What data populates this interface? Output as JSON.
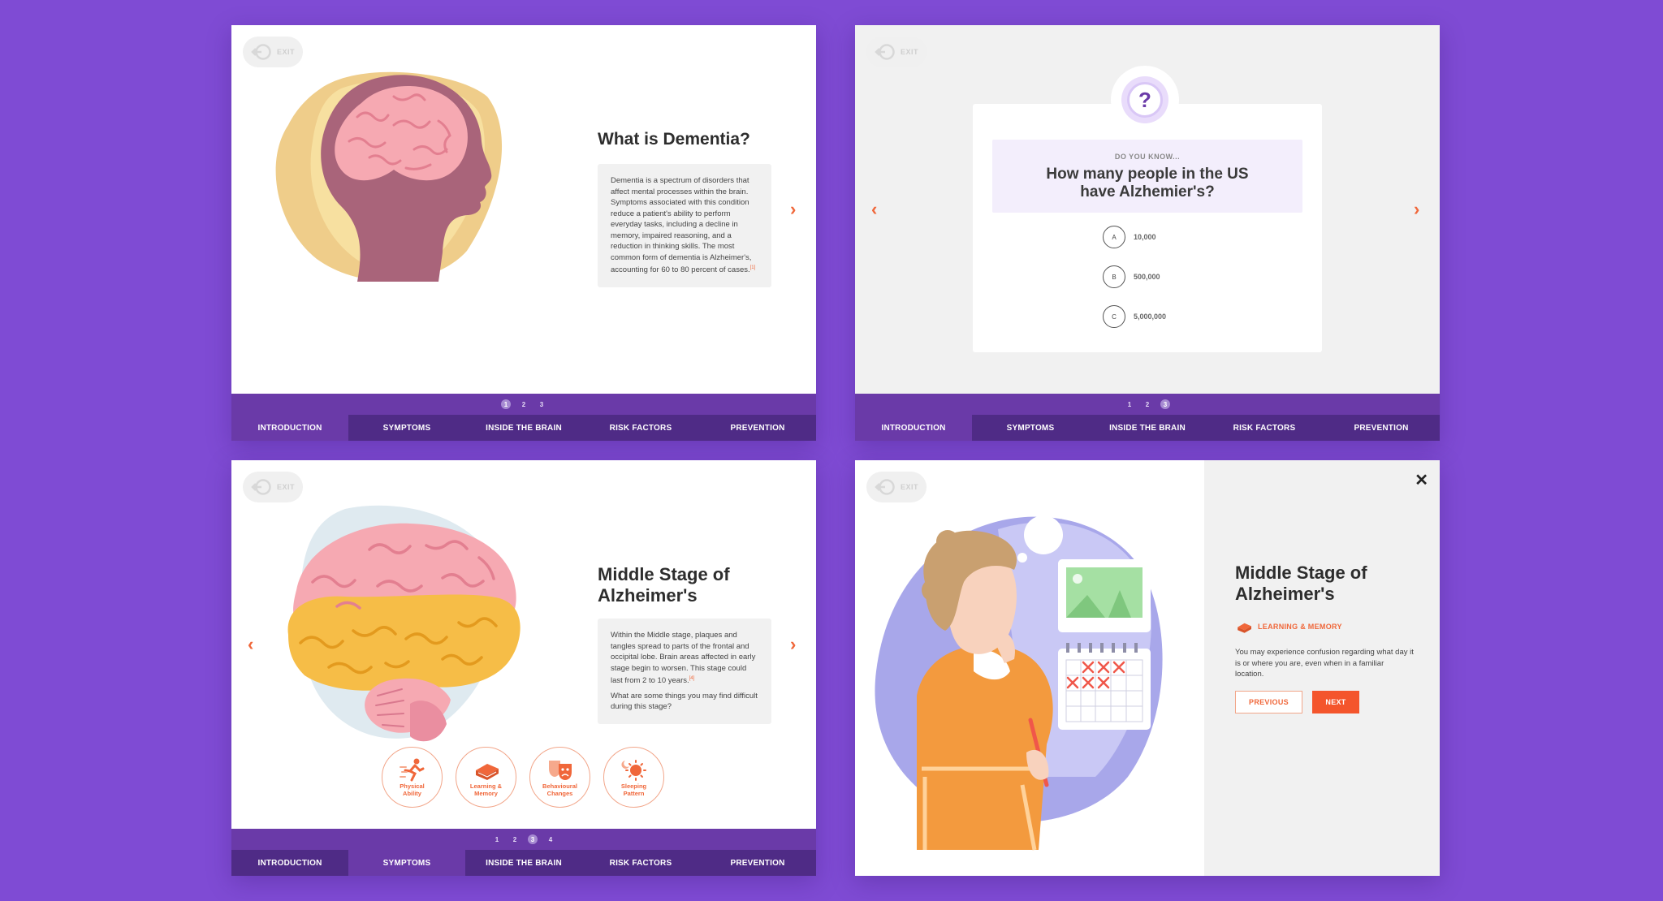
{
  "colors": {
    "background": "#7f4bd4",
    "accent": "#f0673a",
    "nav": "#4f2b86",
    "nav_active": "#6a3aa8"
  },
  "exit_label": "EXIT",
  "tabs": [
    "INTRODUCTION",
    "SYMPTOMS",
    "INSIDE THE BRAIN",
    "RISK FACTORS",
    "PREVENTION"
  ],
  "panel1": {
    "title": "What is Dementia?",
    "body": "Dementia is a spectrum of disorders that affect mental processes within the brain. Symptoms associated with this condition reduce a patient's ability to perform everyday tasks, including a decline in memory, impaired reasoning, and a reduction in thinking skills. The most common form of dementia is Alzheimer's, accounting for 60 to 80 percent of cases.",
    "ref": "[1]",
    "pages": [
      "1",
      "2",
      "3"
    ],
    "active_page": "1",
    "active_tab": "INTRODUCTION"
  },
  "panel2": {
    "pre": "DO YOU KNOW...",
    "question": "How many people in the US have Alzhemier's?",
    "options": [
      {
        "letter": "A",
        "value": "10,000"
      },
      {
        "letter": "B",
        "value": "500,000"
      },
      {
        "letter": "C",
        "value": "5,000,000"
      }
    ],
    "pages": [
      "1",
      "2",
      "3"
    ],
    "active_page": "3",
    "active_tab": "INTRODUCTION"
  },
  "panel3": {
    "title": "Middle Stage of Alzheimer's",
    "body": "Within the Middle stage, plaques and tangles spread to parts of the frontal and occipital lobe. Brain areas affected in early stage begin to worsen. This stage could last from 2 to 10 years.",
    "ref": "[4]",
    "question": "What are some things you may find difficult during this stage?",
    "symptoms": [
      "Physical Ability",
      "Learning & Memory",
      "Behavioural Changes",
      "Sleeping Pattern"
    ],
    "pages": [
      "1",
      "2",
      "3",
      "4"
    ],
    "active_page": "3",
    "active_tab": "SYMPTOMS"
  },
  "panel4": {
    "title": "Middle Stage of Alzheimer's",
    "category": "LEARNING & MEMORY",
    "body": "You may experience confusion regarding what day it is or where you are, even when in a familiar location.",
    "prev": "PREVIOUS",
    "next": "NEXT",
    "close": "✕"
  }
}
